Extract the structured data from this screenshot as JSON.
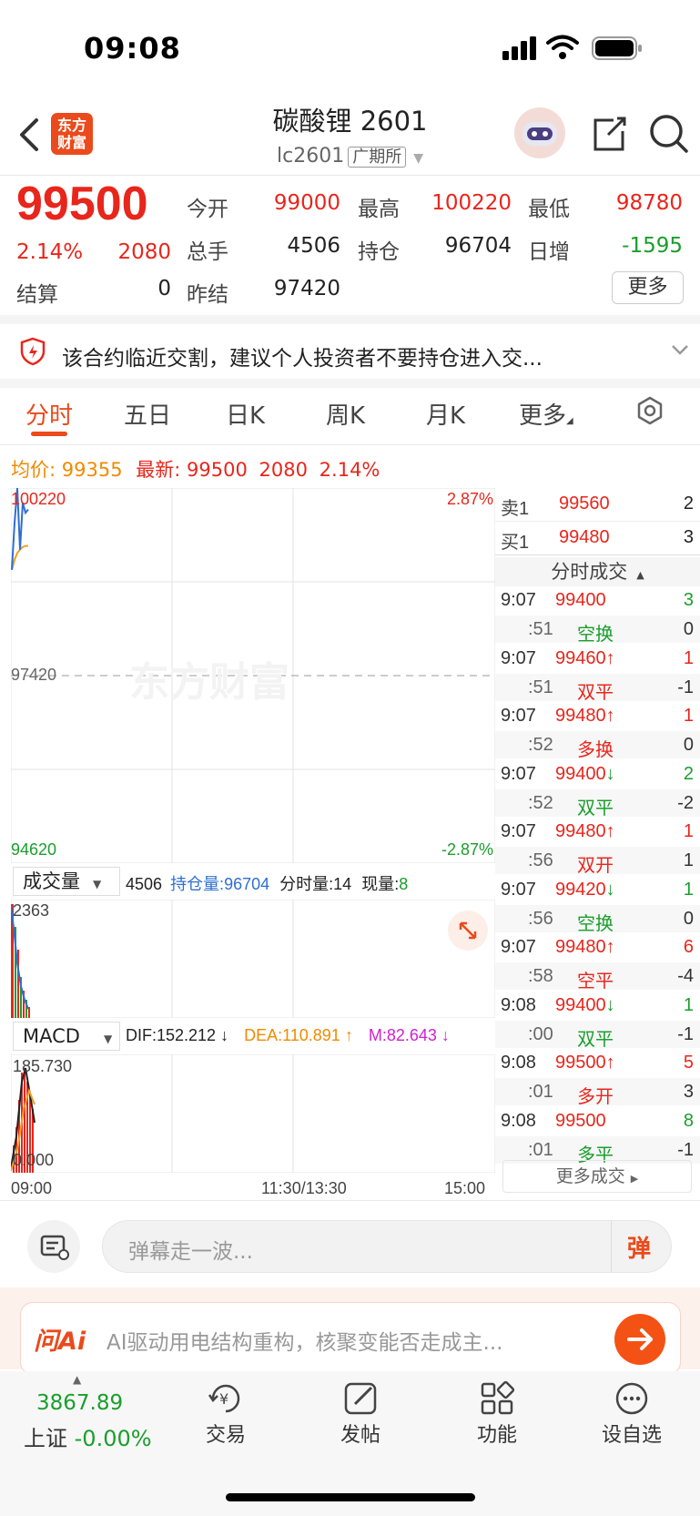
{
  "status": {
    "time": "09:08"
  },
  "header": {
    "logo_text": "东方\n财富",
    "title": "碳酸锂 2601",
    "code": "lc2601",
    "exchange": "广期所"
  },
  "quote": {
    "last": "99500",
    "change_pct": "2.14%",
    "change": "2080",
    "fields": [
      {
        "label": "今开",
        "value": "99000",
        "color": "red"
      },
      {
        "label": "最高",
        "value": "100220",
        "color": "red"
      },
      {
        "label": "最低",
        "value": "98780",
        "color": "red"
      },
      {
        "label": "总手",
        "value": "4506",
        "color": "dark"
      },
      {
        "label": "持仓",
        "value": "96704",
        "color": "dark"
      },
      {
        "label": "日增",
        "value": "-1595",
        "color": "green"
      },
      {
        "label": "结算",
        "value": "0",
        "color": "dark"
      },
      {
        "label": "昨结",
        "value": "97420",
        "color": "dark"
      }
    ],
    "more_label": "更多"
  },
  "notice": {
    "text": "该合约临近交割，建议个人投资者不要持仓进入交..."
  },
  "tabs": [
    "分时",
    "五日",
    "日K",
    "周K",
    "月K",
    "更多"
  ],
  "summary": {
    "avg_label": "均价:",
    "avg": "99355",
    "latest_label": "最新:",
    "latest": "99500",
    "change": "2080",
    "pct": "2.14%"
  },
  "chart": {
    "high_label": "100220",
    "high_pct": "2.87%",
    "mid_label": "97420",
    "watermark": "东方财富",
    "low_label": "94620",
    "low_pct": "-2.87%",
    "time_start": "09:00",
    "time_mid": "11:30/13:30",
    "time_end": "15:00",
    "price_series": [
      99000,
      99700,
      100220,
      99300,
      100000,
      99850,
      99900
    ],
    "avg_series": [
      99000,
      99150,
      99250,
      99300,
      99340,
      99355,
      99355
    ]
  },
  "volume": {
    "selector": "成交量",
    "total": "4506",
    "oi_label": "持仓量:",
    "oi": "96704",
    "tick_label": "分时量:",
    "tick": "14",
    "now_label": "现量:",
    "now": "8",
    "max_label": "2363"
  },
  "macd": {
    "selector": "MACD",
    "dif": "DIF:152.212 ↓",
    "dea": "DEA:110.891 ↑",
    "m": "M:82.643 ↓",
    "max_label": "185.730",
    "zero_label": "0.000"
  },
  "orderbook": [
    {
      "label": "卖1",
      "price": "99560",
      "qty": "2"
    },
    {
      "label": "买1",
      "price": "99480",
      "qty": "3"
    }
  ],
  "ticks_header": "分时成交",
  "ticks": [
    {
      "time": "9:07",
      "price": "99400",
      "arrow": "",
      "qty": "3",
      "qc": "green",
      "sub": ":51",
      "act": "空换",
      "ac": "green",
      "n": "0"
    },
    {
      "time": "9:07",
      "price": "99460",
      "arrow": "↑",
      "qty": "1",
      "qc": "red",
      "sub": ":51",
      "act": "双平",
      "ac": "red",
      "n": "-1"
    },
    {
      "time": "9:07",
      "price": "99480",
      "arrow": "↑",
      "qty": "1",
      "qc": "red",
      "sub": ":52",
      "act": "多换",
      "ac": "red",
      "n": "0"
    },
    {
      "time": "9:07",
      "price": "99400",
      "arrow": "↓",
      "qty": "2",
      "qc": "green",
      "sub": ":52",
      "act": "双平",
      "ac": "green",
      "n": "-2"
    },
    {
      "time": "9:07",
      "price": "99480",
      "arrow": "↑",
      "qty": "1",
      "qc": "red",
      "sub": ":56",
      "act": "双开",
      "ac": "red",
      "n": "1"
    },
    {
      "time": "9:07",
      "price": "99420",
      "arrow": "↓",
      "qty": "1",
      "qc": "green",
      "sub": ":56",
      "act": "空换",
      "ac": "green",
      "n": "0"
    },
    {
      "time": "9:07",
      "price": "99480",
      "arrow": "↑",
      "qty": "6",
      "qc": "red",
      "sub": ":58",
      "act": "空平",
      "ac": "red",
      "n": "-4"
    },
    {
      "time": "9:08",
      "price": "99400",
      "arrow": "↓",
      "qty": "1",
      "qc": "green",
      "sub": ":00",
      "act": "双平",
      "ac": "green",
      "n": "-1"
    },
    {
      "time": "9:08",
      "price": "99500",
      "arrow": "↑",
      "qty": "5",
      "qc": "red",
      "sub": ":01",
      "act": "多开",
      "ac": "red",
      "n": "3"
    },
    {
      "time": "9:08",
      "price": "99500",
      "arrow": "",
      "qty": "8",
      "qc": "green",
      "sub": ":01",
      "act": "多平",
      "ac": "green",
      "n": "-1"
    }
  ],
  "more_ticks": "更多成交",
  "comment": {
    "placeholder": "弹幕走一波...",
    "send": "弹"
  },
  "ai": {
    "logo": "问Ai",
    "text": "AI驱动用电结构重构，核聚变能否走成主..."
  },
  "bottom": {
    "index_value": "3867.89",
    "index_name": "上证",
    "index_pct": "-0.00%",
    "nav": [
      "交易",
      "发帖",
      "功能",
      "设自选"
    ]
  },
  "colors": {
    "red": "#e8261c",
    "green": "#1a9e2c",
    "orange": "#f08a00",
    "brand": "#ea4a1c",
    "blue": "#2e6fd1"
  }
}
